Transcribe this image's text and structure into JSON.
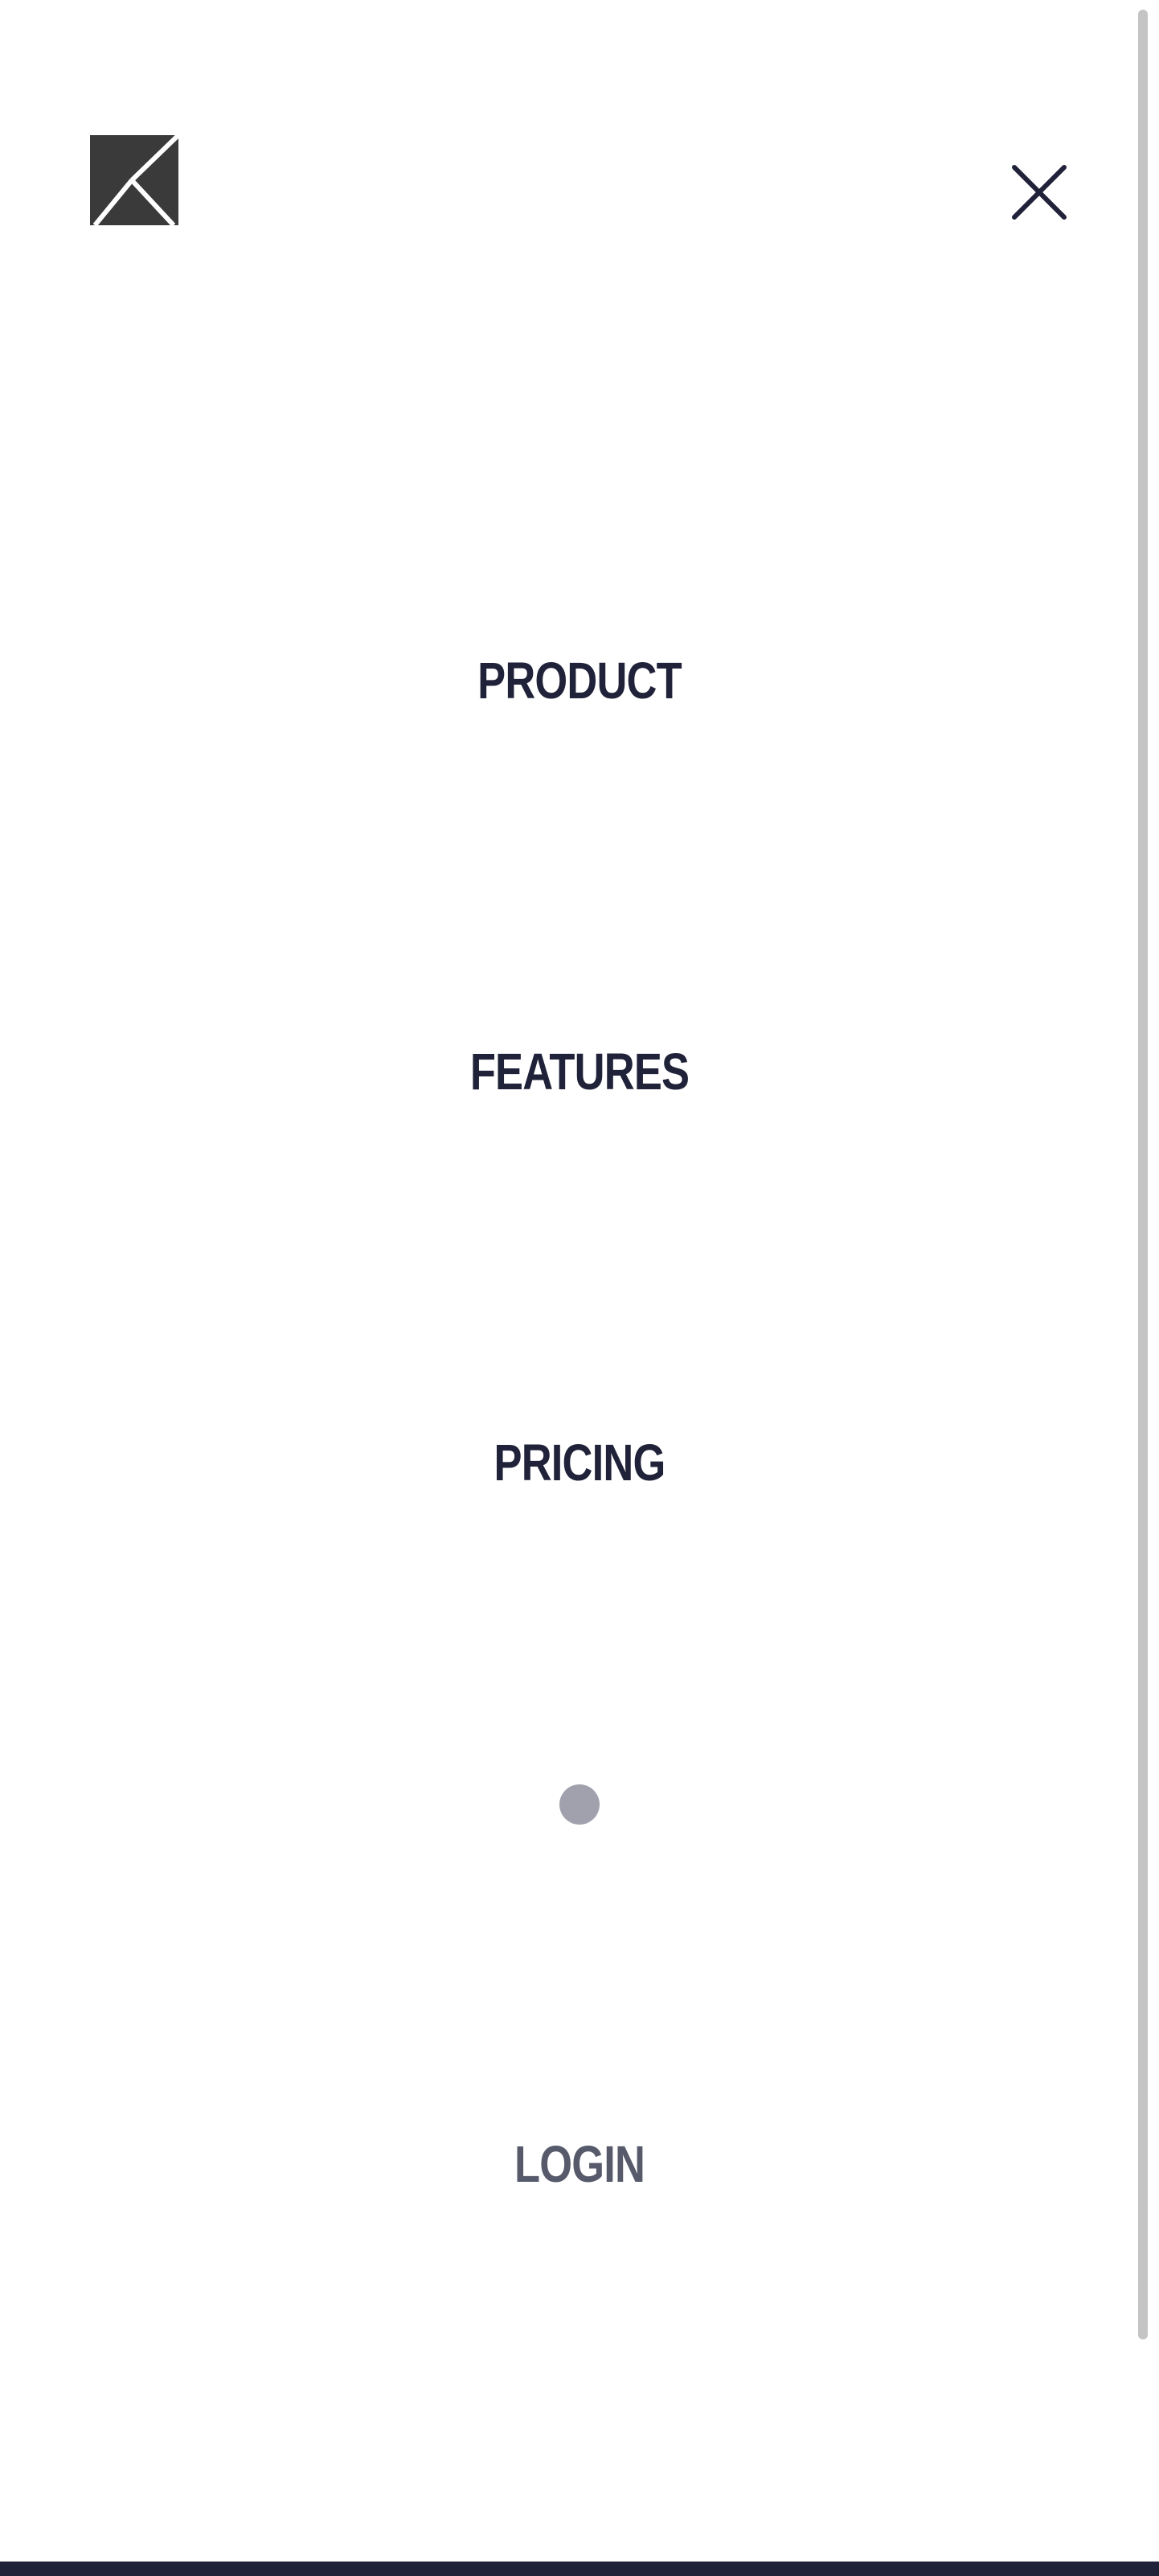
{
  "logo": {
    "icon": "k-monogram-icon"
  },
  "close": {
    "icon": "close-icon"
  },
  "menu": {
    "items": [
      {
        "label": "PRODUCT"
      },
      {
        "label": "FEATURES"
      },
      {
        "label": "PRICING"
      }
    ],
    "login_label": "LOGIN"
  },
  "colors": {
    "text_primary": "#1f2238",
    "text_muted": "#575a6b",
    "dot": "#a1a1ad",
    "logo": "#3a3a3a",
    "scrollbar": "#c4c4c4",
    "background": "#ffffff"
  }
}
